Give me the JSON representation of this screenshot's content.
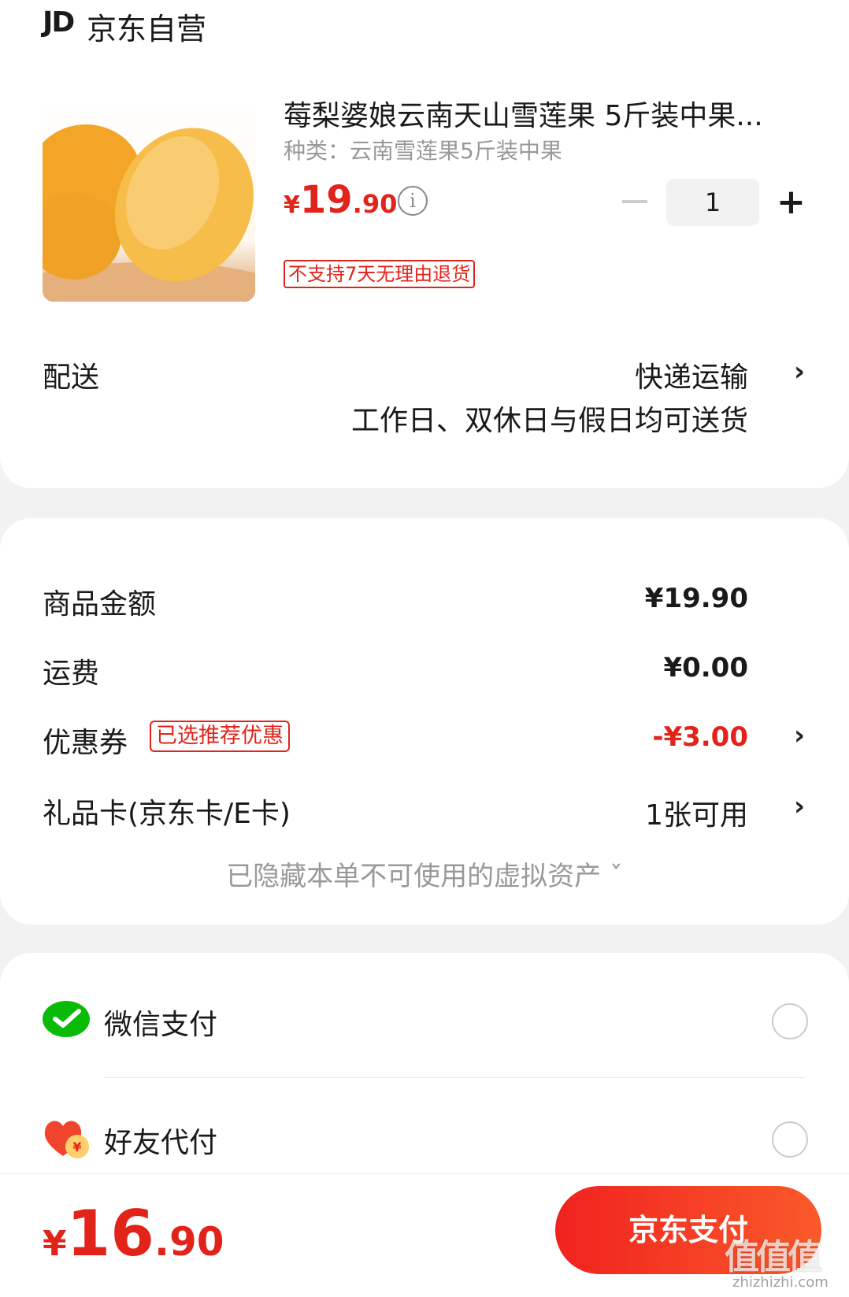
{
  "shop": {
    "logo": "JD",
    "name": "京东自营"
  },
  "product": {
    "title": "莓梨婆娘云南天山雪莲果 5斤装中果...",
    "spec": "种类：云南雪莲果5斤装中果",
    "price_currency": "¥",
    "price_int": "19",
    "price_dec": ".90",
    "info_icon": "i",
    "quantity": "1",
    "plus": "+",
    "return_policy": "不支持7天无理由退货"
  },
  "delivery": {
    "label": "配送",
    "method": "快递运输",
    "note": "工作日、双休日与假日均可送货",
    "chevron": "›"
  },
  "amounts": {
    "goods_label": "商品金额",
    "goods_value": "¥19.90",
    "shipping_label": "运费",
    "shipping_value": "¥0.00",
    "coupon_label": "优惠券",
    "coupon_badge": "已选推荐优惠",
    "coupon_value": "-¥3.00",
    "giftcard_label": "礼品卡(京东卡/E卡)",
    "giftcard_value": "1张可用",
    "chevron": "›",
    "hidden_assets": "已隐藏本单不可使用的虚拟资产 ˇ"
  },
  "payment": {
    "wechat_label": "微信支付",
    "friend_label": "好友代付",
    "wechat_color": "#09bb07",
    "friend_color": "#f0442c"
  },
  "bottom": {
    "total_currency": "¥",
    "total_int": "16",
    "total_dec": ".90",
    "pay_button": "京东支付",
    "watermark": "值值值",
    "watermark_url": "zhizhizhi.com"
  }
}
